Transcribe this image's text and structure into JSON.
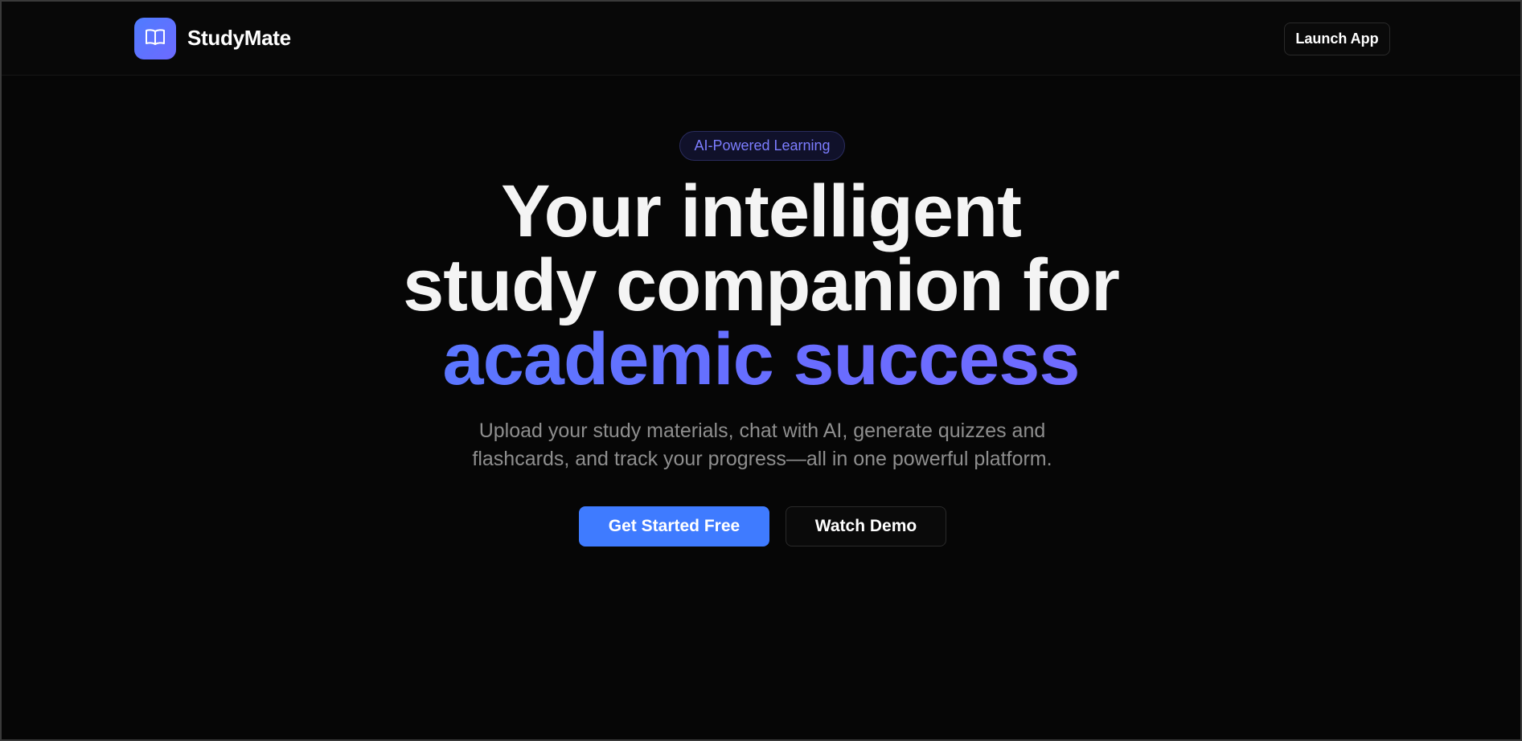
{
  "header": {
    "brand": "StudyMate",
    "logo_icon": "open-book-icon",
    "launch_label": "Launch App"
  },
  "hero": {
    "badge": "AI-Powered Learning",
    "headline_line1": "Your intelligent",
    "headline_line2": "study companion for",
    "headline_accent": "academic success",
    "subtitle_line1": "Upload your study materials, chat with AI, generate quizzes and",
    "subtitle_line2": "flashcards, and track your progress—all in one powerful platform.",
    "primary_cta": "Get Started Free",
    "secondary_cta": "Watch Demo"
  },
  "colors": {
    "background": "#060606",
    "accent_blue": "#3f7bff",
    "accent_violet": "#7b6bff",
    "badge_text": "#7c7dff"
  }
}
